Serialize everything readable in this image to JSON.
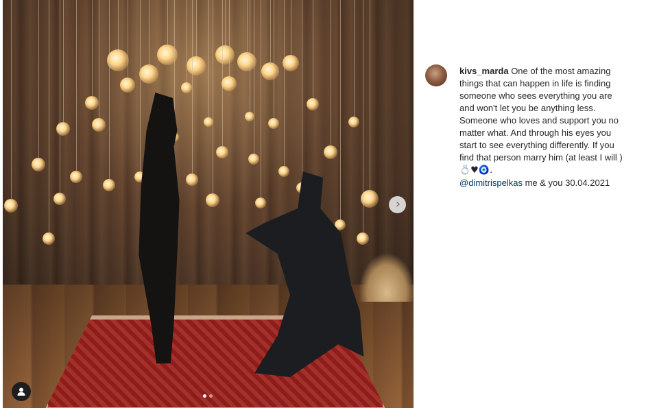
{
  "post": {
    "username": "kivs_marda",
    "caption_text": "One of the most amazing things that can happen in life is finding someone who sees everything you are and won't let you be anything less. Someone who loves and support you no matter what. And through his eyes you start to see everything differently. If you find that person marry him (at least I will )",
    "caption_emojis": "💍♥🧿.",
    "mention": "@dimitrispelkas",
    "caption_tail": " me & you 30.04.2021"
  },
  "media": {
    "next_icon": "chevron-right-icon",
    "user_tag_icon": "user-icon",
    "carousel_count": 2,
    "carousel_active": 1
  },
  "colors": {
    "mention": "#00376b",
    "text": "#262626",
    "tag_button": "#1e1e1e"
  }
}
